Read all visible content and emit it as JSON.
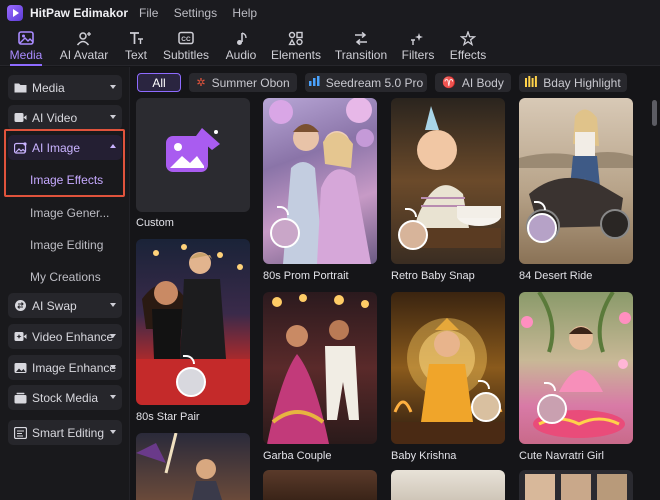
{
  "app": {
    "name": "HitPaw Edimakor",
    "menu": [
      "File",
      "Settings",
      "Help"
    ]
  },
  "toolbar": {
    "tabs": [
      {
        "label": "Media",
        "icon": "media-icon",
        "active": true
      },
      {
        "label": "AI Avatar",
        "icon": "avatar-icon"
      },
      {
        "label": "Text",
        "icon": "text-icon"
      },
      {
        "label": "Subtitles",
        "icon": "subtitles-icon"
      },
      {
        "label": "Audio",
        "icon": "audio-icon"
      },
      {
        "label": "Elements",
        "icon": "elements-icon"
      },
      {
        "label": "Transition",
        "icon": "transition-icon"
      },
      {
        "label": "Filters",
        "icon": "filters-icon"
      },
      {
        "label": "Effects",
        "icon": "effects-icon"
      }
    ]
  },
  "sidebar": {
    "items": [
      {
        "label": "Media",
        "icon": "folder-icon"
      },
      {
        "label": "AI Video",
        "icon": "video-icon"
      },
      {
        "label": "AI Image",
        "icon": "image-icon",
        "expanded": true
      },
      {
        "label": "AI Swap",
        "icon": "swap-icon"
      },
      {
        "label": "Video Enhance",
        "icon": "enhance-icon"
      },
      {
        "label": "Image Enhance",
        "icon": "image-enhance-icon"
      },
      {
        "label": "Stock Media",
        "icon": "stock-icon"
      },
      {
        "label": "Smart Editing",
        "icon": "smart-editing-icon"
      }
    ],
    "sub_items": [
      {
        "label": "Image Effects",
        "active": true
      },
      {
        "label": "Image Gener..."
      },
      {
        "label": "Image Editing"
      },
      {
        "label": "My Creations"
      }
    ]
  },
  "filters": [
    {
      "label": "All",
      "active": true
    },
    {
      "label": "Summer Obon",
      "icon": "sparkle-icon",
      "color": "#e0533c"
    },
    {
      "label": "Seedream 5.0 Pro",
      "icon": "chart-icon",
      "color": "#4aa3ff"
    },
    {
      "label": "AI Body",
      "icon": "body-icon",
      "color": "#ff5b8a"
    },
    {
      "label": "Bday Highlight",
      "icon": "bars-icon",
      "color": "#ffd24a"
    }
  ],
  "cards": [
    {
      "caption": "Custom",
      "kind": "custom"
    },
    {
      "caption": "80s Prom Portrait"
    },
    {
      "caption": "Retro Baby Snap"
    },
    {
      "caption": "84 Desert Ride"
    },
    {
      "caption": "80s Star Pair"
    },
    {
      "caption": "Garba Couple"
    },
    {
      "caption": "Baby Krishna"
    },
    {
      "caption": "Cute Navratri Girl"
    }
  ],
  "colors": {
    "accent": "#8e6bff",
    "highlight": "#e0533c",
    "background": "#151518"
  }
}
